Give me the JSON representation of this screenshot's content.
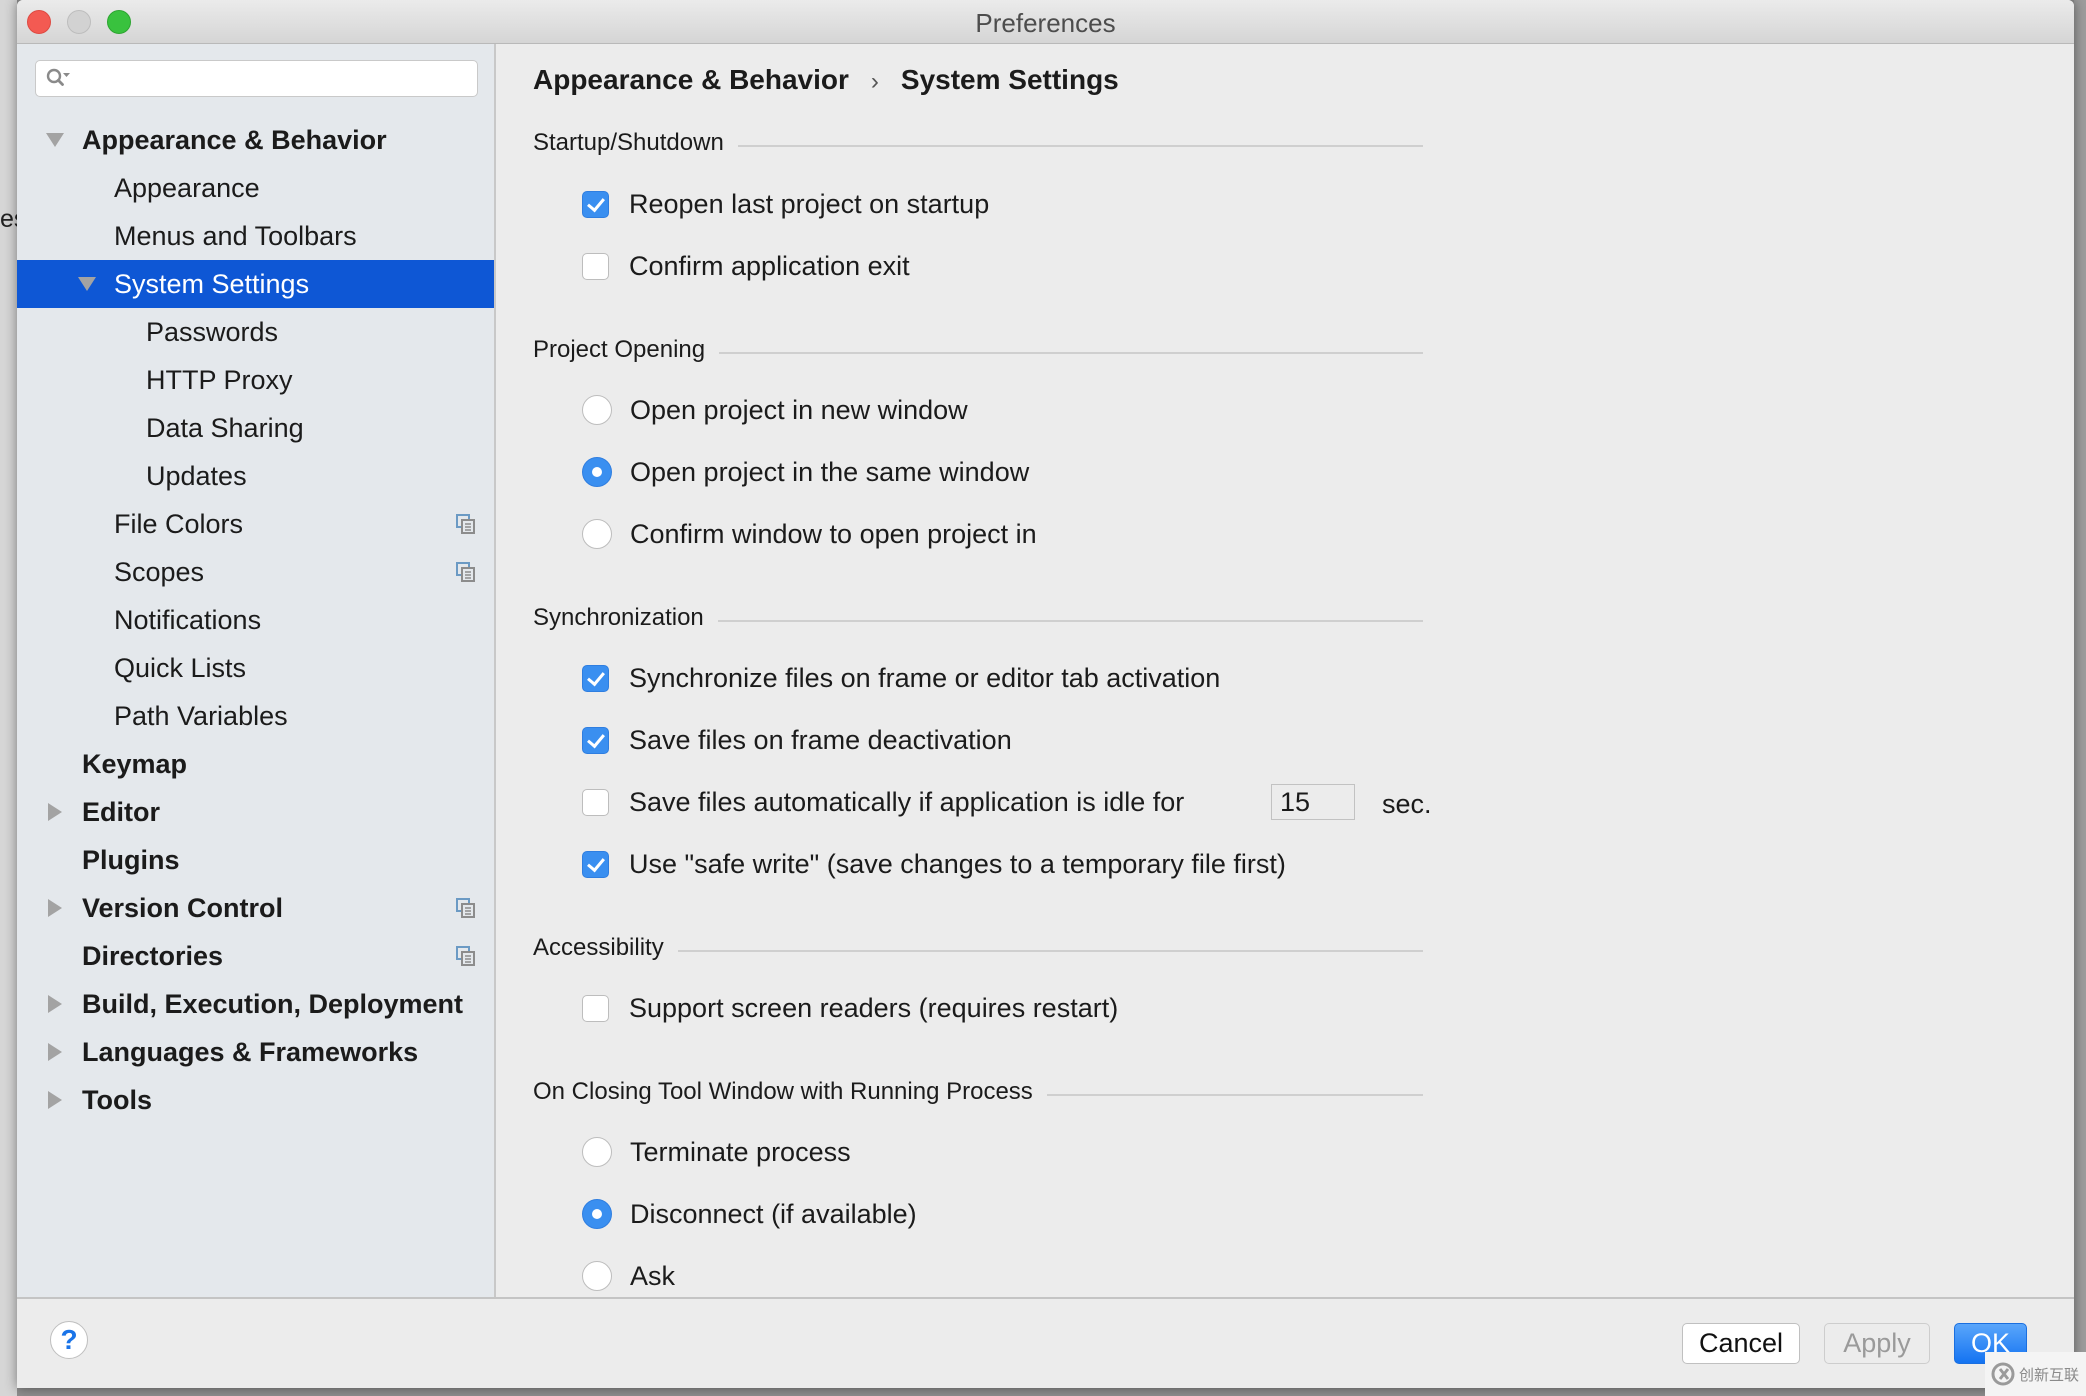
{
  "window": {
    "title": "Preferences"
  },
  "background": {
    "peek_text": "es"
  },
  "sidebar": {
    "search": {
      "value": "",
      "placeholder": ""
    },
    "items": [
      {
        "label": "Appearance & Behavior",
        "level": 0,
        "bold": true,
        "arrow": "down"
      },
      {
        "label": "Appearance",
        "level": 1,
        "bold": false
      },
      {
        "label": "Menus and Toolbars",
        "level": 1,
        "bold": false
      },
      {
        "label": "System Settings",
        "level": 1,
        "bold": false,
        "arrow": "down",
        "selected": true
      },
      {
        "label": "Passwords",
        "level": 2,
        "bold": false
      },
      {
        "label": "HTTP Proxy",
        "level": 2,
        "bold": false
      },
      {
        "label": "Data Sharing",
        "level": 2,
        "bold": false
      },
      {
        "label": "Updates",
        "level": 2,
        "bold": false
      },
      {
        "label": "File Colors",
        "level": 1,
        "bold": false,
        "project_icon": true
      },
      {
        "label": "Scopes",
        "level": 1,
        "bold": false,
        "project_icon": true
      },
      {
        "label": "Notifications",
        "level": 1,
        "bold": false
      },
      {
        "label": "Quick Lists",
        "level": 1,
        "bold": false
      },
      {
        "label": "Path Variables",
        "level": 1,
        "bold": false
      },
      {
        "label": "Keymap",
        "level": 0,
        "bold": true
      },
      {
        "label": "Editor",
        "level": 0,
        "bold": true,
        "arrow": "right"
      },
      {
        "label": "Plugins",
        "level": 0,
        "bold": true
      },
      {
        "label": "Version Control",
        "level": 0,
        "bold": true,
        "arrow": "right",
        "project_icon": true
      },
      {
        "label": "Directories",
        "level": 0,
        "bold": true,
        "project_icon": true
      },
      {
        "label": "Build, Execution, Deployment",
        "level": 0,
        "bold": true,
        "arrow": "right"
      },
      {
        "label": "Languages & Frameworks",
        "level": 0,
        "bold": true,
        "arrow": "right"
      },
      {
        "label": "Tools",
        "level": 0,
        "bold": true,
        "arrow": "right"
      }
    ]
  },
  "content": {
    "breadcrumb": {
      "parent": "Appearance & Behavior",
      "separator": "›",
      "current": "System Settings"
    },
    "sections": {
      "startup": {
        "title": "Startup/Shutdown",
        "options": [
          {
            "label": "Reopen last project on startup",
            "checked": true
          },
          {
            "label": "Confirm application exit",
            "checked": false
          }
        ]
      },
      "project_opening": {
        "title": "Project Opening",
        "options": [
          {
            "label": "Open project in new window",
            "selected": false
          },
          {
            "label": "Open project in the same window",
            "selected": true
          },
          {
            "label": "Confirm window to open project in",
            "selected": false
          }
        ]
      },
      "sync": {
        "title": "Synchronization",
        "options": [
          {
            "label": "Synchronize files on frame or editor tab activation",
            "checked": true
          },
          {
            "label": "Save files on frame deactivation",
            "checked": true
          },
          {
            "label": "Save files automatically if application is idle for",
            "checked": false,
            "value": "15",
            "unit": "sec."
          },
          {
            "label": "Use \"safe write\" (save changes to a temporary file first)",
            "checked": true
          }
        ]
      },
      "accessibility": {
        "title": "Accessibility",
        "options": [
          {
            "label": "Support screen readers (requires restart)",
            "checked": false
          }
        ]
      },
      "closing": {
        "title": "On Closing Tool Window with Running Process",
        "options": [
          {
            "label": "Terminate process",
            "selected": false
          },
          {
            "label": "Disconnect (if available)",
            "selected": true
          },
          {
            "label": "Ask",
            "selected": false
          }
        ]
      }
    }
  },
  "footer": {
    "help_label": "?",
    "cancel_label": "Cancel",
    "apply_label": "Apply",
    "ok_label": "OK"
  },
  "watermark": {
    "text": "创新互联"
  },
  "colors": {
    "selection": "#0e57d5",
    "accent": "#3a8ff0",
    "sidebar_bg": "#e4e8ec",
    "panel_bg": "#ececec"
  }
}
